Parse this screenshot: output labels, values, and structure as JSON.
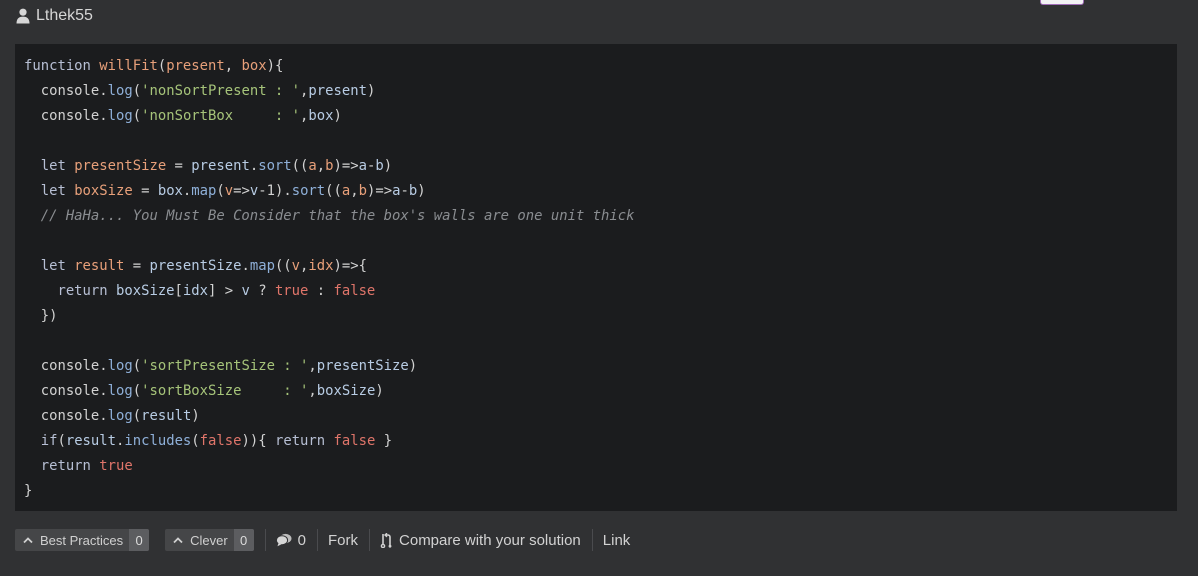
{
  "author": {
    "username": "Lthek55",
    "icon": "user-icon"
  },
  "code": {
    "language": "javascript",
    "lines": [
      [
        [
          "kw",
          "function "
        ],
        [
          "fn",
          "willFit"
        ],
        [
          "punct",
          "("
        ],
        [
          "param",
          "present"
        ],
        [
          "punct",
          ", "
        ],
        [
          "param",
          "box"
        ],
        [
          "punct",
          "){"
        ]
      ],
      [
        [
          "plain",
          "  console"
        ],
        [
          "punct",
          "."
        ],
        [
          "method",
          "log"
        ],
        [
          "punct",
          "("
        ],
        [
          "str",
          "'nonSortPresent : '"
        ],
        [
          "punct",
          ","
        ],
        [
          "ident",
          "present"
        ],
        [
          "punct",
          ")"
        ]
      ],
      [
        [
          "plain",
          "  console"
        ],
        [
          "punct",
          "."
        ],
        [
          "method",
          "log"
        ],
        [
          "punct",
          "("
        ],
        [
          "str",
          "'nonSortBox     : '"
        ],
        [
          "punct",
          ","
        ],
        [
          "ident",
          "box"
        ],
        [
          "punct",
          ")"
        ]
      ],
      [],
      [
        [
          "kw",
          "  let "
        ],
        [
          "var",
          "presentSize"
        ],
        [
          "punct",
          " = "
        ],
        [
          "ident",
          "present"
        ],
        [
          "punct",
          "."
        ],
        [
          "method",
          "sort"
        ],
        [
          "punct",
          "(("
        ],
        [
          "param",
          "a"
        ],
        [
          "punct",
          ","
        ],
        [
          "param",
          "b"
        ],
        [
          "punct",
          ")=>"
        ],
        [
          "ident",
          "a"
        ],
        [
          "punct",
          "-"
        ],
        [
          "ident",
          "b"
        ],
        [
          "punct",
          ")"
        ]
      ],
      [
        [
          "kw",
          "  let "
        ],
        [
          "var",
          "boxSize"
        ],
        [
          "punct",
          " = "
        ],
        [
          "ident",
          "box"
        ],
        [
          "punct",
          "."
        ],
        [
          "method",
          "map"
        ],
        [
          "punct",
          "("
        ],
        [
          "param",
          "v"
        ],
        [
          "punct",
          "=>"
        ],
        [
          "ident",
          "v"
        ],
        [
          "punct",
          "-1)."
        ],
        [
          "method",
          "sort"
        ],
        [
          "punct",
          "(("
        ],
        [
          "param",
          "a"
        ],
        [
          "punct",
          ","
        ],
        [
          "param",
          "b"
        ],
        [
          "punct",
          ")=>"
        ],
        [
          "ident",
          "a"
        ],
        [
          "punct",
          "-"
        ],
        [
          "ident",
          "b"
        ],
        [
          "punct",
          ")"
        ]
      ],
      [
        [
          "comment",
          "  // HaHa... You Must Be Consider that the box's walls are one unit thick"
        ]
      ],
      [],
      [
        [
          "kw",
          "  let "
        ],
        [
          "var",
          "result"
        ],
        [
          "punct",
          " = "
        ],
        [
          "ident",
          "presentSize"
        ],
        [
          "punct",
          "."
        ],
        [
          "method",
          "map"
        ],
        [
          "punct",
          "(("
        ],
        [
          "param",
          "v"
        ],
        [
          "punct",
          ","
        ],
        [
          "param",
          "idx"
        ],
        [
          "punct",
          ")=>{"
        ]
      ],
      [
        [
          "kw",
          "    return "
        ],
        [
          "ident",
          "boxSize"
        ],
        [
          "punct",
          "["
        ],
        [
          "ident",
          "idx"
        ],
        [
          "punct",
          "] > "
        ],
        [
          "ident",
          "v"
        ],
        [
          "punct",
          " ? "
        ],
        [
          "bool",
          "true"
        ],
        [
          "punct",
          " : "
        ],
        [
          "bool",
          "false"
        ]
      ],
      [
        [
          "punct",
          "  })"
        ]
      ],
      [],
      [
        [
          "plain",
          "  console"
        ],
        [
          "punct",
          "."
        ],
        [
          "method",
          "log"
        ],
        [
          "punct",
          "("
        ],
        [
          "str",
          "'sortPresentSize : '"
        ],
        [
          "punct",
          ","
        ],
        [
          "ident",
          "presentSize"
        ],
        [
          "punct",
          ")"
        ]
      ],
      [
        [
          "plain",
          "  console"
        ],
        [
          "punct",
          "."
        ],
        [
          "method",
          "log"
        ],
        [
          "punct",
          "("
        ],
        [
          "str",
          "'sortBoxSize     : '"
        ],
        [
          "punct",
          ","
        ],
        [
          "ident",
          "boxSize"
        ],
        [
          "punct",
          ")"
        ]
      ],
      [
        [
          "plain",
          "  console"
        ],
        [
          "punct",
          "."
        ],
        [
          "method",
          "log"
        ],
        [
          "punct",
          "("
        ],
        [
          "ident",
          "result"
        ],
        [
          "punct",
          ")"
        ]
      ],
      [
        [
          "kw",
          "  if"
        ],
        [
          "punct",
          "("
        ],
        [
          "ident",
          "result"
        ],
        [
          "punct",
          "."
        ],
        [
          "method",
          "includes"
        ],
        [
          "punct",
          "("
        ],
        [
          "bool",
          "false"
        ],
        [
          "punct",
          "))"
        ],
        [
          "punct",
          "{ "
        ],
        [
          "kw",
          "return "
        ],
        [
          "bool",
          "false"
        ],
        [
          "punct",
          " }"
        ]
      ],
      [
        [
          "kw",
          "  return "
        ],
        [
          "bool",
          "true"
        ]
      ],
      [
        [
          "punct",
          "}"
        ]
      ]
    ]
  },
  "actions": {
    "best_practices": {
      "label": "Best Practices",
      "count": "0",
      "icon": "chevron-up-icon"
    },
    "clever": {
      "label": "Clever",
      "count": "0",
      "icon": "chevron-up-icon"
    },
    "comments": {
      "count": "0",
      "icon": "comment-icon"
    },
    "fork": {
      "label": "Fork"
    },
    "compare": {
      "label": "Compare with your solution",
      "icon": "compare-icon"
    },
    "link": {
      "label": "Link"
    }
  },
  "colors": {
    "page_bg": "#303133",
    "code_bg": "#1b1c1e",
    "string": "#a6c47a",
    "keyword": "#b7bfd4",
    "function": "#e8a07a",
    "boolean": "#e0756a",
    "comment": "#8a8d91"
  }
}
